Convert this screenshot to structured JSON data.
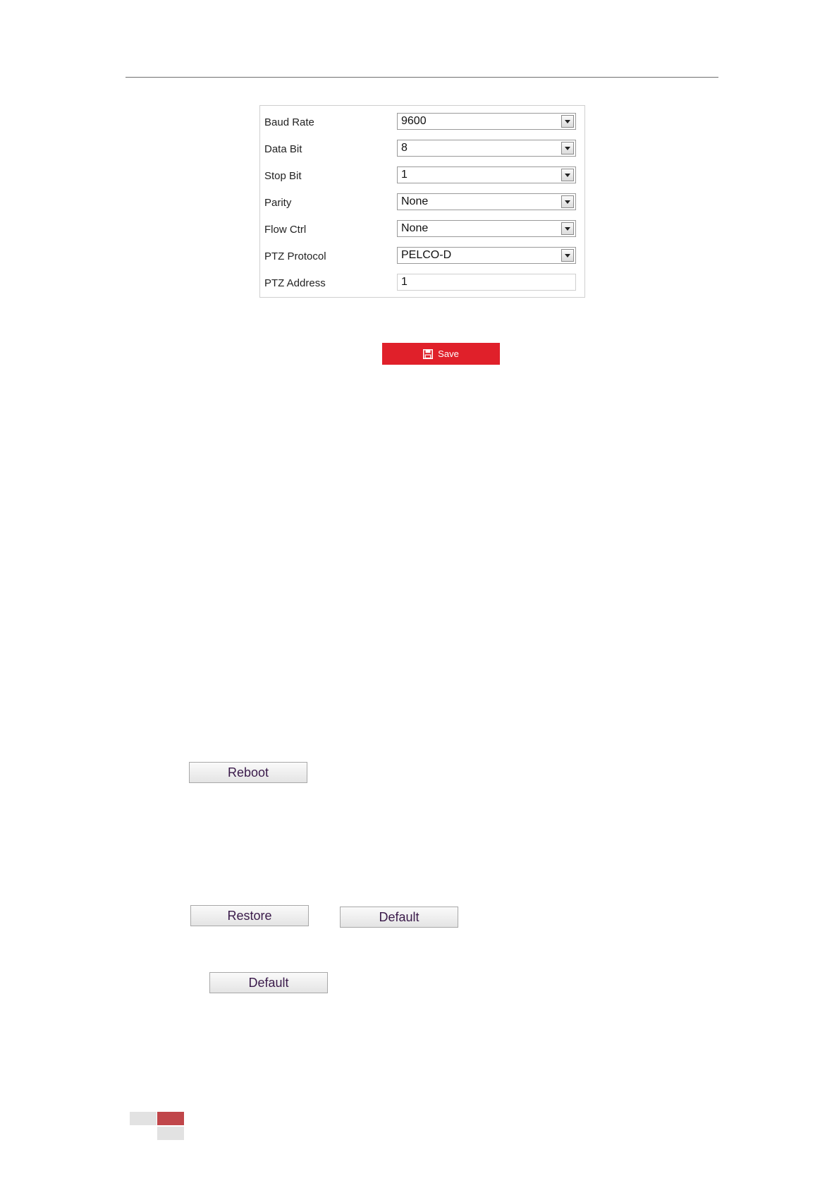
{
  "serial_settings": {
    "rows": [
      {
        "label": "Baud Rate",
        "value": "9600",
        "control": "select"
      },
      {
        "label": "Data Bit",
        "value": "8",
        "control": "select"
      },
      {
        "label": "Stop Bit",
        "value": "1",
        "control": "select"
      },
      {
        "label": "Parity",
        "value": "None",
        "control": "select"
      },
      {
        "label": "Flow Ctrl",
        "value": "None",
        "control": "select"
      },
      {
        "label": "PTZ Protocol",
        "value": "PELCO-D",
        "control": "select"
      },
      {
        "label": "PTZ Address",
        "value": "1",
        "control": "text"
      }
    ]
  },
  "save_button": {
    "label": "Save",
    "icon": "save-icon",
    "color": "#e0202a"
  },
  "maintenance": {
    "reboot_label": "Reboot",
    "restore_label": "Restore",
    "default_label": "Default",
    "default_label_2": "Default"
  },
  "footer": {
    "accent_color": "#c0464a",
    "neutral_color": "#e2e2e2"
  }
}
